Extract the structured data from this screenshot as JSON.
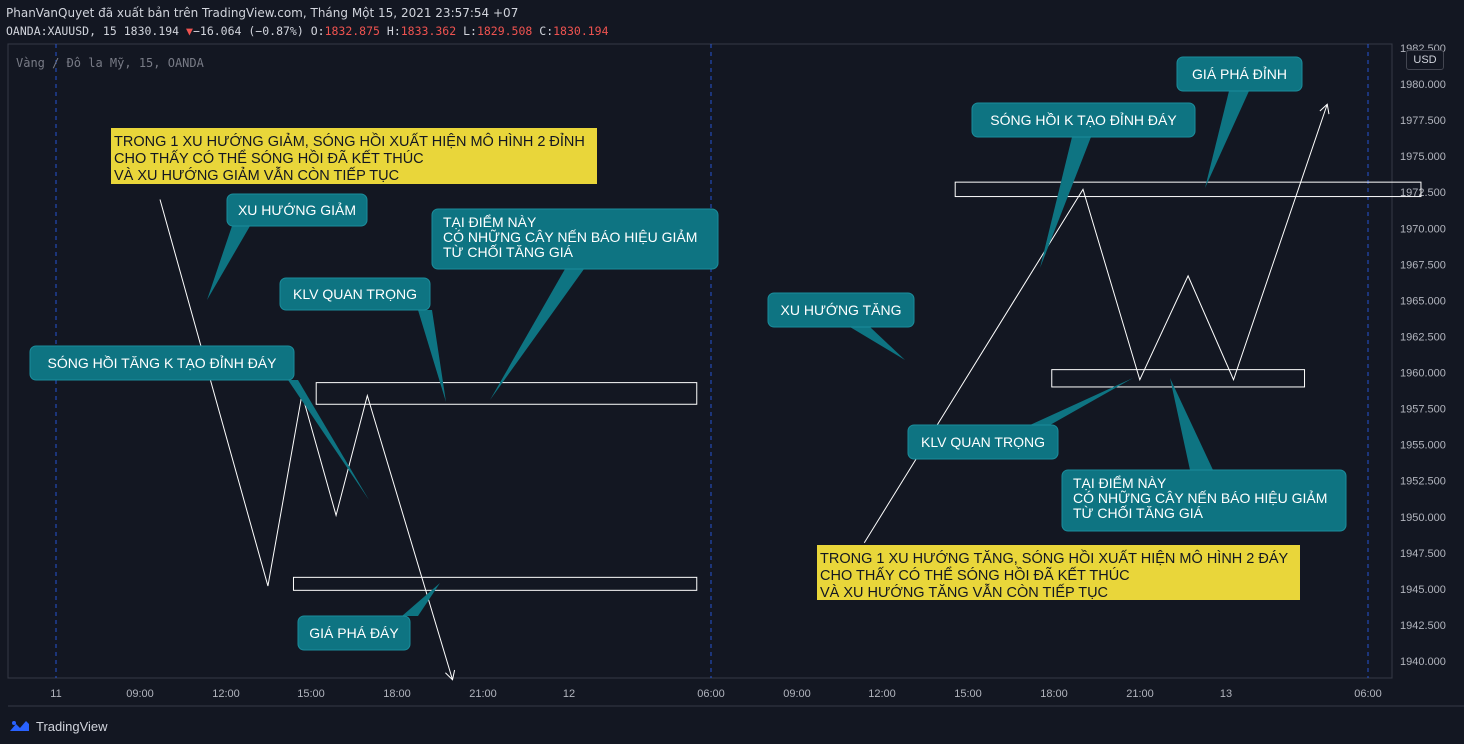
{
  "header": {
    "publisher": "PhanVanQuyet đã xuất bản trên TradingView.com, Tháng Một 15, 2021 23:57:54 +07",
    "symbol": "OANDA:XAUUSD, 15",
    "last": "1830.194",
    "change": "−16.064 (−0.87%)",
    "o_label": "O:",
    "o": "1832.875",
    "h_label": "H:",
    "h": "1833.362",
    "l_label": "L:",
    "l": "1829.508",
    "c_label": "C:",
    "c": "1830.194"
  },
  "watermark": "Vàng / Đô la Mỹ, 15, OANDA",
  "currency": "USD",
  "footer": {
    "brand": "TradingView"
  },
  "colors": {
    "background": "#131722",
    "callout": "#0e7482",
    "note": "#e9d63a",
    "line": "#ffffff",
    "axis_text": "#b2b5be",
    "separator": "#2962ff"
  },
  "chart_data": {
    "type": "line",
    "title": "",
    "yaxis": {
      "ticks": [
        "1982.500",
        "1980.000",
        "1977.500",
        "1975.000",
        "1972.500",
        "1970.000",
        "1967.500",
        "1965.000",
        "1962.500",
        "1960.000",
        "1957.500",
        "1955.000",
        "1952.500",
        "1950.000",
        "1947.500",
        "1945.000",
        "1942.500",
        "1940.000"
      ],
      "range": [
        1938.5,
        1983
      ]
    },
    "xaxis": {
      "ticks": [
        "11",
        "09:00",
        "12:00",
        "15:00",
        "18:00",
        "21:00",
        "12",
        "06:00",
        "09:00",
        "12:00",
        "15:00",
        "18:00",
        "21:00",
        "13",
        "06:00"
      ]
    },
    "series": [
      {
        "points": [
          [
            0.0,
            1972.0
          ],
          [
            3.8,
            1945.2
          ],
          [
            5.0,
            1958.5
          ],
          [
            6.2,
            1950.1
          ],
          [
            7.3,
            1958.4
          ],
          [
            10.3,
            1938.7
          ]
        ]
      },
      {
        "points": [
          [
            24.8,
            1948.2
          ],
          [
            32.5,
            1972.7
          ],
          [
            34.5,
            1959.5
          ],
          [
            36.2,
            1966.7
          ],
          [
            37.8,
            1959.5
          ],
          [
            41.1,
            1978.6
          ]
        ]
      }
    ],
    "zones": [
      {
        "x": [
          5.5,
          18.9
        ],
        "y": [
          1957.8,
          1959.3
        ]
      },
      {
        "x": [
          4.7,
          18.9
        ],
        "y": [
          1944.9,
          1945.8
        ]
      },
      {
        "x": [
          28.0,
          44.4
        ],
        "y": [
          1972.2,
          1973.2
        ]
      },
      {
        "x": [
          31.4,
          40.3
        ],
        "y": [
          1959.0,
          1960.2
        ]
      }
    ],
    "callouts": [
      {
        "text": [
          "XU HƯỚNG GIẢM"
        ]
      },
      {
        "text": [
          "KLV QUAN TRỌNG"
        ]
      },
      {
        "text": [
          "TẠI ĐIỂM NÀY",
          "CÓ NHỮNG CÂY NẾN BÁO HIỆU GIẢM",
          "TỪ CHỐI TĂNG GIÁ"
        ]
      },
      {
        "text": [
          "SÓNG HỒI TĂNG K TẠO ĐỈNH ĐÁY"
        ]
      },
      {
        "text": [
          "GIÁ PHÁ ĐÁY"
        ]
      },
      {
        "text": [
          "GIÁ PHÁ ĐỈNH"
        ]
      },
      {
        "text": [
          "SÓNG HỒI K TẠO ĐỈNH ĐÁY"
        ]
      },
      {
        "text": [
          "XU HƯỚNG TĂNG"
        ]
      },
      {
        "text": [
          "KLV QUAN TRỌNG"
        ]
      },
      {
        "text": [
          "TẠI ĐIỂM NÀY",
          "CÓ NHỮNG CÂY NẾN BÁO HIỆU GIẢM",
          "TỪ CHỐI TĂNG GIÁ"
        ]
      }
    ],
    "notes": [
      {
        "text": [
          "TRONG 1 XU HƯỚNG GIẢM, SÓNG HỒI XUẤT HIỆN MÔ HÌNH 2 ĐỈNH",
          "CHO THẤY CÓ THỂ SÓNG HỒI ĐÃ KẾT THÚC",
          "VÀ XU HƯỚNG GIẢM VẪN CÒN TIẾP TỤC"
        ]
      },
      {
        "text": [
          "TRONG 1 XU HƯỚNG TĂNG, SÓNG HỒI XUẤT HIỆN MÔ HÌNH 2 ĐÁY",
          "CHO THẤY CÓ THỂ SÓNG HỒI ĐÃ KẾT THÚC",
          "VÀ XU HƯỚNG TĂNG VẪN CÒN TIẾP TỤC"
        ]
      }
    ]
  }
}
